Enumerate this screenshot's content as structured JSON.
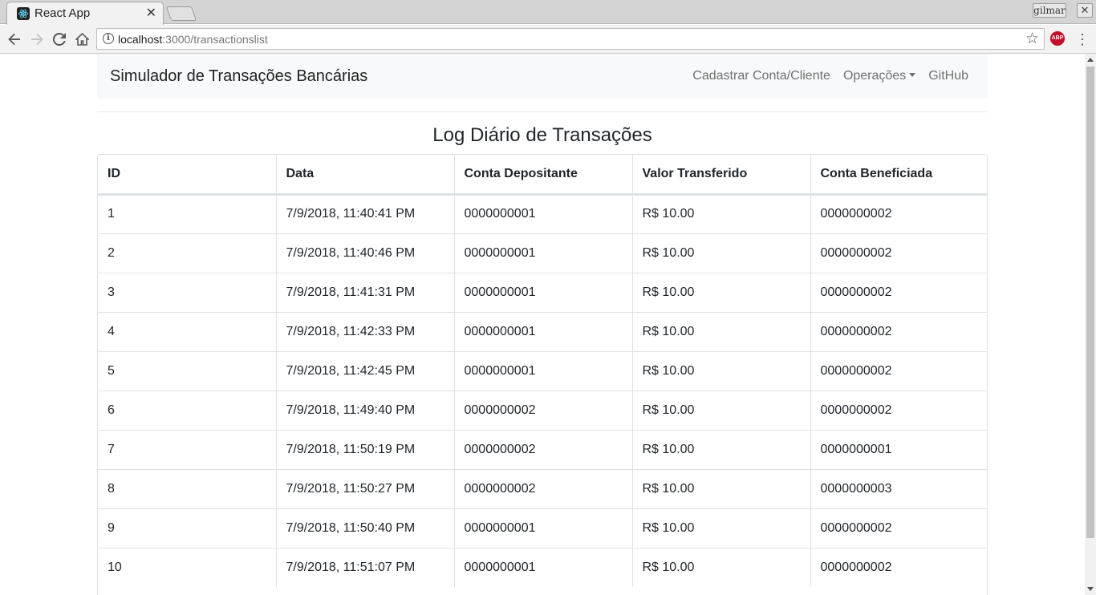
{
  "browser": {
    "tab_title": "React App",
    "tab_close": "✕",
    "profile": "gilmar",
    "window_close": "✕",
    "url_host": "localhost",
    "url_path": ":3000/transactionslist",
    "icons": [
      "back-icon",
      "forward-icon",
      "reload-icon",
      "home-icon",
      "info-icon",
      "bookmark-star-icon",
      "adblock-icon",
      "menu-icon"
    ],
    "abp_label": "ABP"
  },
  "navbar": {
    "brand": "Simulador de Transações Bancárias",
    "links": {
      "register": "Cadastrar Conta/Cliente",
      "operations": "Operações",
      "github": "GitHub"
    }
  },
  "page": {
    "title": "Log Diário de Transações"
  },
  "table": {
    "headers": [
      "ID",
      "Data",
      "Conta Depositante",
      "Valor Transferido",
      "Conta Beneficiada"
    ],
    "rows": [
      [
        "1",
        "7/9/2018, 11:40:41 PM",
        "0000000001",
        "R$ 10.00",
        "0000000002"
      ],
      [
        "2",
        "7/9/2018, 11:40:46 PM",
        "0000000001",
        "R$ 10.00",
        "0000000002"
      ],
      [
        "3",
        "7/9/2018, 11:41:31 PM",
        "0000000001",
        "R$ 10.00",
        "0000000002"
      ],
      [
        "4",
        "7/9/2018, 11:42:33 PM",
        "0000000001",
        "R$ 10.00",
        "0000000002"
      ],
      [
        "5",
        "7/9/2018, 11:42:45 PM",
        "0000000001",
        "R$ 10.00",
        "0000000002"
      ],
      [
        "6",
        "7/9/2018, 11:49:40 PM",
        "0000000002",
        "R$ 10.00",
        "0000000002"
      ],
      [
        "7",
        "7/9/2018, 11:50:19 PM",
        "0000000002",
        "R$ 10.00",
        "0000000001"
      ],
      [
        "8",
        "7/9/2018, 11:50:27 PM",
        "0000000002",
        "R$ 10.00",
        "0000000003"
      ],
      [
        "9",
        "7/9/2018, 11:50:40 PM",
        "0000000001",
        "R$ 10.00",
        "0000000002"
      ],
      [
        "10",
        "7/9/2018, 11:51:07 PM",
        "0000000001",
        "R$ 10.00",
        "0000000002"
      ]
    ]
  }
}
